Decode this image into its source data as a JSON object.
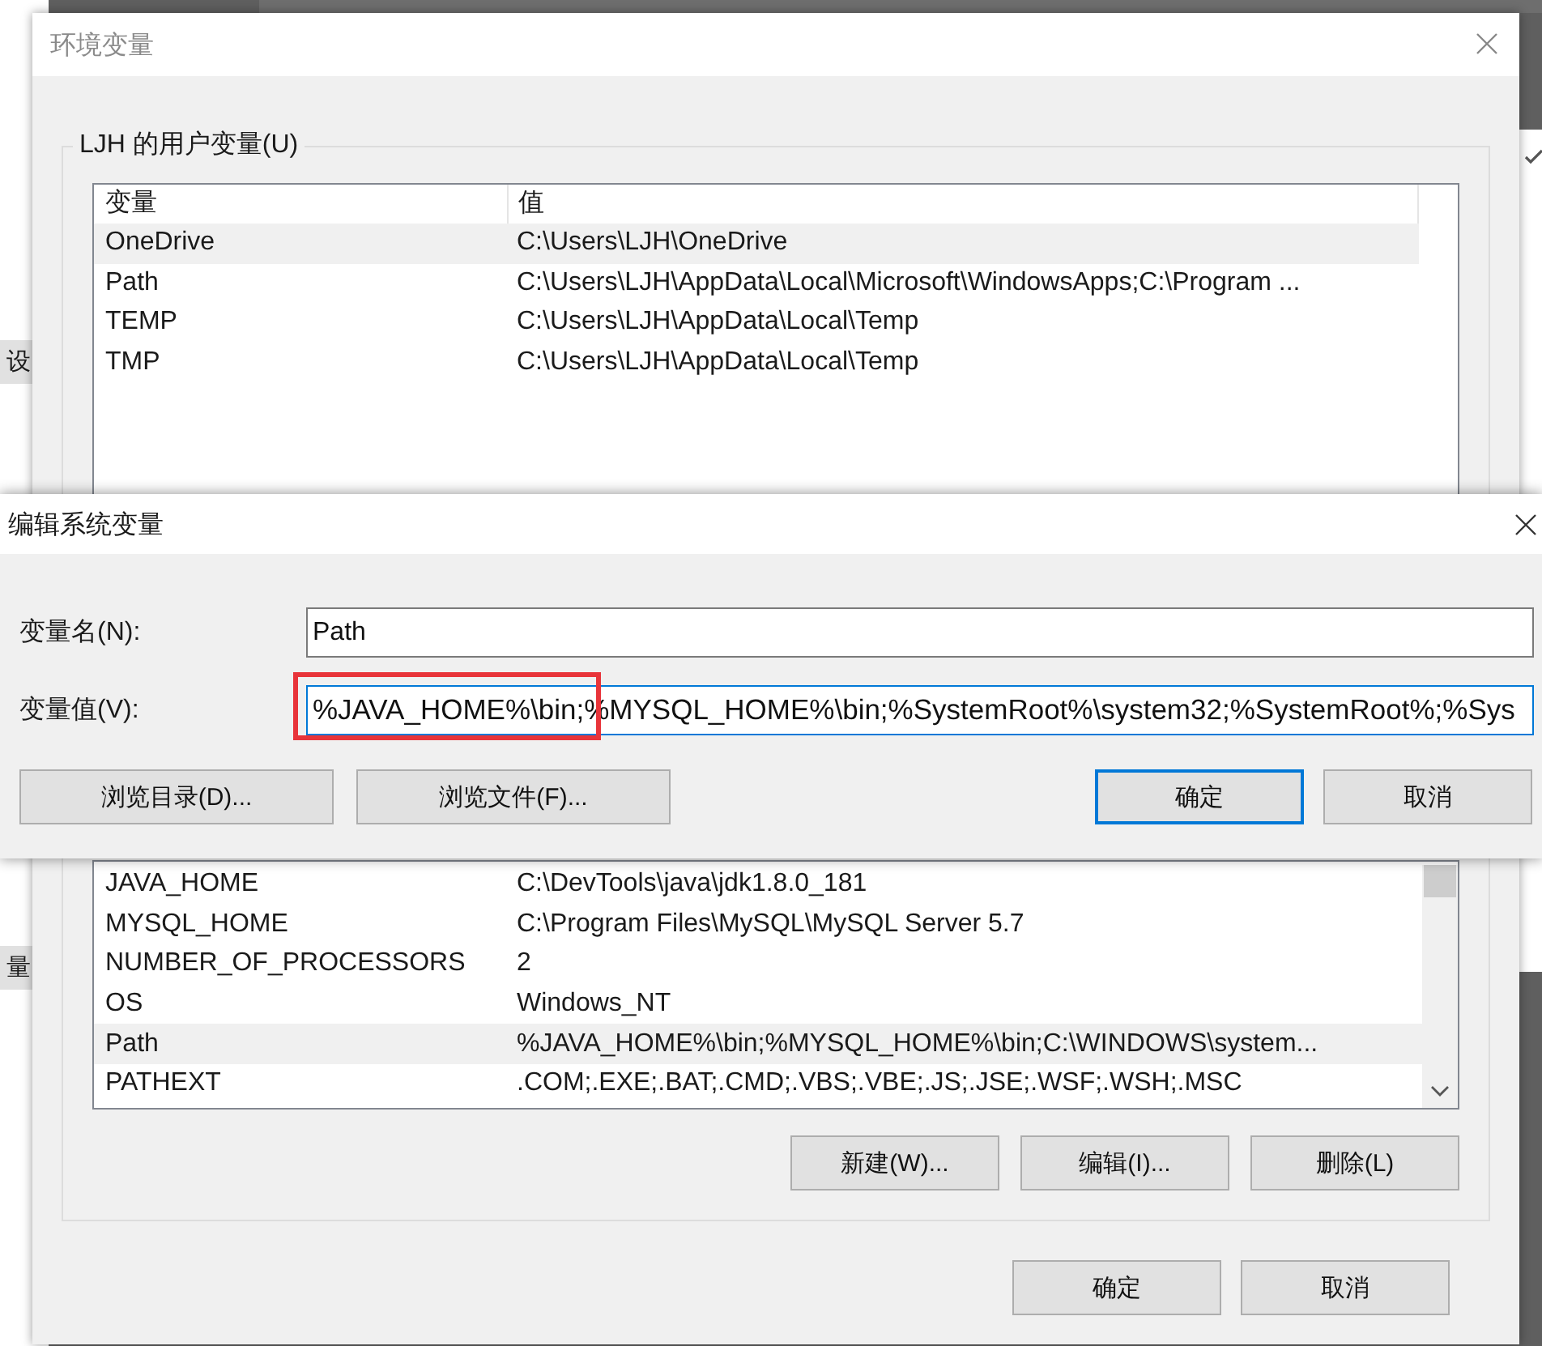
{
  "background_window": {
    "button_1": "设",
    "button_2": "量"
  },
  "dialog": {
    "title": "环境变量",
    "user_group": {
      "label": "LJH 的用户变量(U)",
      "columns": [
        "变量",
        "值"
      ],
      "rows": [
        {
          "name": "OneDrive",
          "value": "C:\\Users\\LJH\\OneDrive",
          "selected": true
        },
        {
          "name": "Path",
          "value": "C:\\Users\\LJH\\AppData\\Local\\Microsoft\\WindowsApps;C:\\Program ...",
          "selected": false
        },
        {
          "name": "TEMP",
          "value": "C:\\Users\\LJH\\AppData\\Local\\Temp",
          "selected": false
        },
        {
          "name": "TMP",
          "value": "C:\\Users\\LJH\\AppData\\Local\\Temp",
          "selected": false
        }
      ]
    },
    "system_group": {
      "rows": [
        {
          "name": "JAVA_HOME",
          "value": "C:\\DevTools\\java\\jdk1.8.0_181",
          "selected": false
        },
        {
          "name": "MYSQL_HOME",
          "value": "C:\\Program Files\\MySQL\\MySQL Server 5.7",
          "selected": false
        },
        {
          "name": "NUMBER_OF_PROCESSORS",
          "value": "2",
          "selected": false
        },
        {
          "name": "OS",
          "value": "Windows_NT",
          "selected": false
        },
        {
          "name": "Path",
          "value": "%JAVA_HOME%\\bin;%MYSQL_HOME%\\bin;C:\\WINDOWS\\system...",
          "selected": true
        },
        {
          "name": "PATHEXT",
          "value": ".COM;.EXE;.BAT;.CMD;.VBS;.VBE;.JS;.JSE;.WSF;.WSH;.MSC",
          "selected": false
        }
      ],
      "buttons": [
        "新建(W)...",
        "编辑(I)...",
        "删除(L)"
      ]
    },
    "footer_buttons": [
      "确定",
      "取消"
    ]
  },
  "edit_dialog": {
    "title": "编辑系统变量",
    "name_label": "变量名(N):",
    "name_value": "Path",
    "value_label": "变量值(V):",
    "value_value": "%JAVA_HOME%\\bin;%MYSQL_HOME%\\bin;%SystemRoot%\\system32;%SystemRoot%;%Sys",
    "value_focused": true,
    "buttons": [
      {
        "label": "浏览目录(D)...",
        "default": false
      },
      {
        "label": "浏览文件(F)...",
        "default": false
      },
      {
        "label": "确定",
        "default": true
      },
      {
        "label": "取消",
        "default": false
      }
    ]
  }
}
